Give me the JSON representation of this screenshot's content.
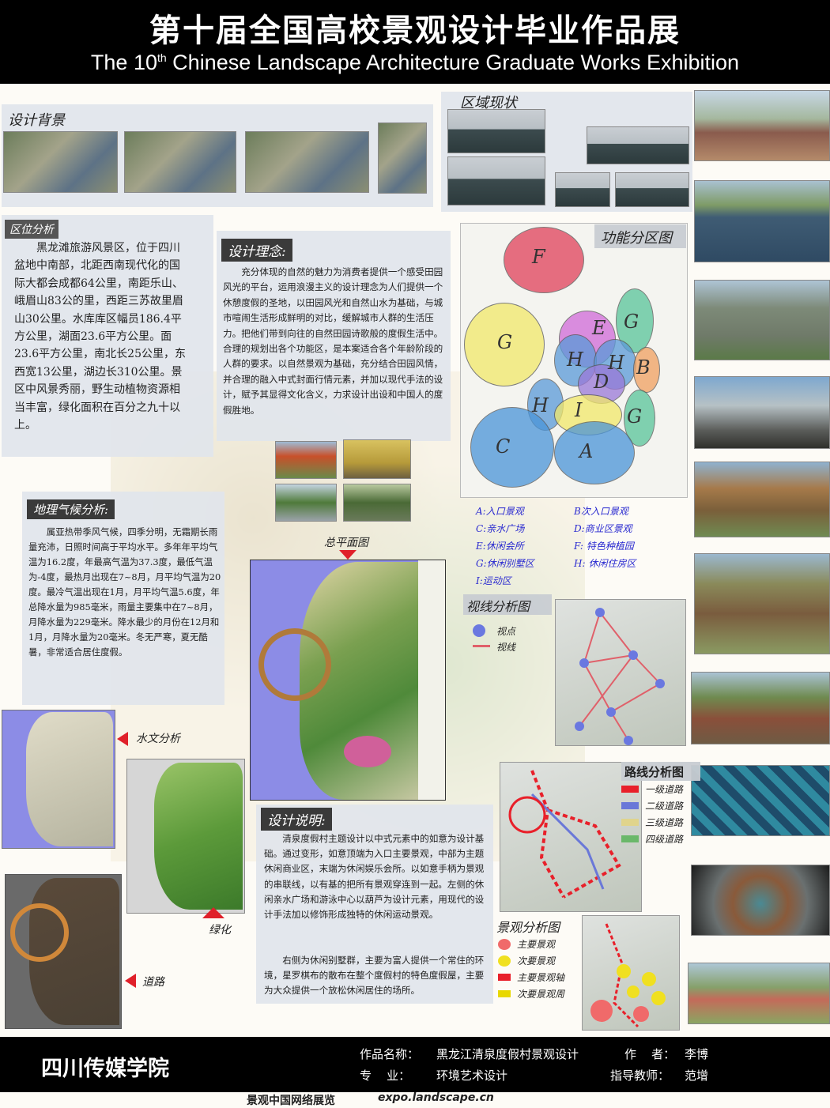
{
  "header": {
    "title_cn": "第十届全国高校景观设计毕业作品展",
    "title_en_prefix": "The 10",
    "title_en_sup": "th",
    "title_en_suffix": " Chinese Landscape Architecture Graduate Works Exhibition"
  },
  "sections": {
    "background": "设计背景",
    "current": "区域现状",
    "location": "区位分析",
    "concept": "设计理念:",
    "function_map": "功能分区图",
    "climate": "地理气候分析:",
    "master_plan": "总平面图",
    "sight": "视线分析图",
    "hydro": "水文分析",
    "green": "绿化",
    "road": "道路",
    "route": "路线分析图",
    "description": "设计说明:",
    "landscape": "景观分析图"
  },
  "location_text": "黑龙滩旅游风景区，位于四川盆地中南部，北距西南现代化的国际大都会成都64公里，南距乐山、峨眉山83公的里，西距三苏故里眉山30公里。水库库区幅员186.4平方公里，湖面23.6平方公里。面23.6平方公里，南北长25公里，东西宽13公里，湖边长310公里。景区中风景秀丽，野生动植物资源相当丰富，绿化面积在百分之九十以上。",
  "concept_text": "充分体现的自然的魅力为消费者提供一个感受田园风光的平台，运用浪漫主义的设计理念为人们提供一个休憩度假的圣地，以田园风光和自然山水为基础，与城市喧闹生活形成鲜明的对比，缓解城市人群的生活压力。把他们带到向往的自然田园诗歌般的度假生活中。合理的规划出各个功能区，是本案适合各个年龄阶段的人群的要求。以自然景观为基础，充分结合田园风情，并合理的融入中式封面行情元素，并加以现代手法的设计，赋予其显得文化含义，力求设计出设和中国人的度假胜地。",
  "climate_text": "属亚热带季风气候，四季分明，无霜期长雨量充沛，日照时间高于平均水平。多年年平均气温为16.2度，年最高气温为37.3度，最低气温为-4度，最热月出现在7~8月，月平均气温为20度。最冷气温出现在1月，月平均气温5.6度，年总降水量为985毫米，雨量主要集中在7~8月，月降水量为229毫米。降水最少的月份在12月和1月，月降水量为20毫米。冬无严寒，夏无酷暑，非常适合居住度假。",
  "description_text_1": "清泉度假村主题设计以中式元素中的如意为设计基础。通过变形，如意顶端为入口主要景观，中部为主题休闲商业区，末端为休闲娱乐会所。以如意手柄为景观的串联线，以有基的把所有景观穿连到一起。左侧的休闲亲水广场和游泳中心以葫芦为设计元素，用现代的设计手法加以修饰形成独特的休闲运动景观。",
  "description_text_2": "右侧为休闲别墅群，主要为富人提供一个常住的环境，星罗棋布的散布在整个度假村的特色度假屋，主要为大众提供一个放松休闲居住的场所。",
  "zones": [
    "F",
    "G",
    "E",
    "G",
    "H",
    "H",
    "B",
    "D",
    "H",
    "I",
    "G",
    "C",
    "A"
  ],
  "zone_legend": [
    [
      "A:入口景观",
      "B次入口景观"
    ],
    [
      "C:亲水广场",
      "D:商业区景观"
    ],
    [
      "E:休闲会所",
      "F: 特色种植园"
    ],
    [
      "G:休闲别墅区",
      "H: 休闲住房区"
    ],
    [
      "I:运动区",
      ""
    ]
  ],
  "sight_legend": {
    "point": "视点",
    "line": "视线"
  },
  "route_legend": [
    {
      "label": "一级道路",
      "color": "#e8202a"
    },
    {
      "label": "二级道路",
      "color": "#6a78d8"
    },
    {
      "label": "三级道路",
      "color": "#e0d48c"
    },
    {
      "label": "四级道路",
      "color": "#6ab86a"
    }
  ],
  "landscape_legend": [
    {
      "label": "主要景观",
      "color": "#f06a6a",
      "shape": "dot"
    },
    {
      "label": "次要景观",
      "color": "#f0e020",
      "shape": "dot"
    },
    {
      "label": "主要景观轴",
      "color": "#e8202a",
      "shape": "bar"
    },
    {
      "label": "次要景观周",
      "color": "#e8d800",
      "shape": "bar"
    }
  ],
  "footer": {
    "school": "四川传媒学院",
    "work_label": "作品名称：",
    "work_value": "黑龙江清泉度假村景观设计",
    "author_label": "作    者：",
    "author_value": "李博",
    "major_label": "专    业：",
    "major_value": "环境艺术设计",
    "advisor_label": "指导教师：",
    "advisor_value": "范增",
    "site_cn": "景观中国网络展览",
    "site_url": "expo.landscape.cn"
  }
}
